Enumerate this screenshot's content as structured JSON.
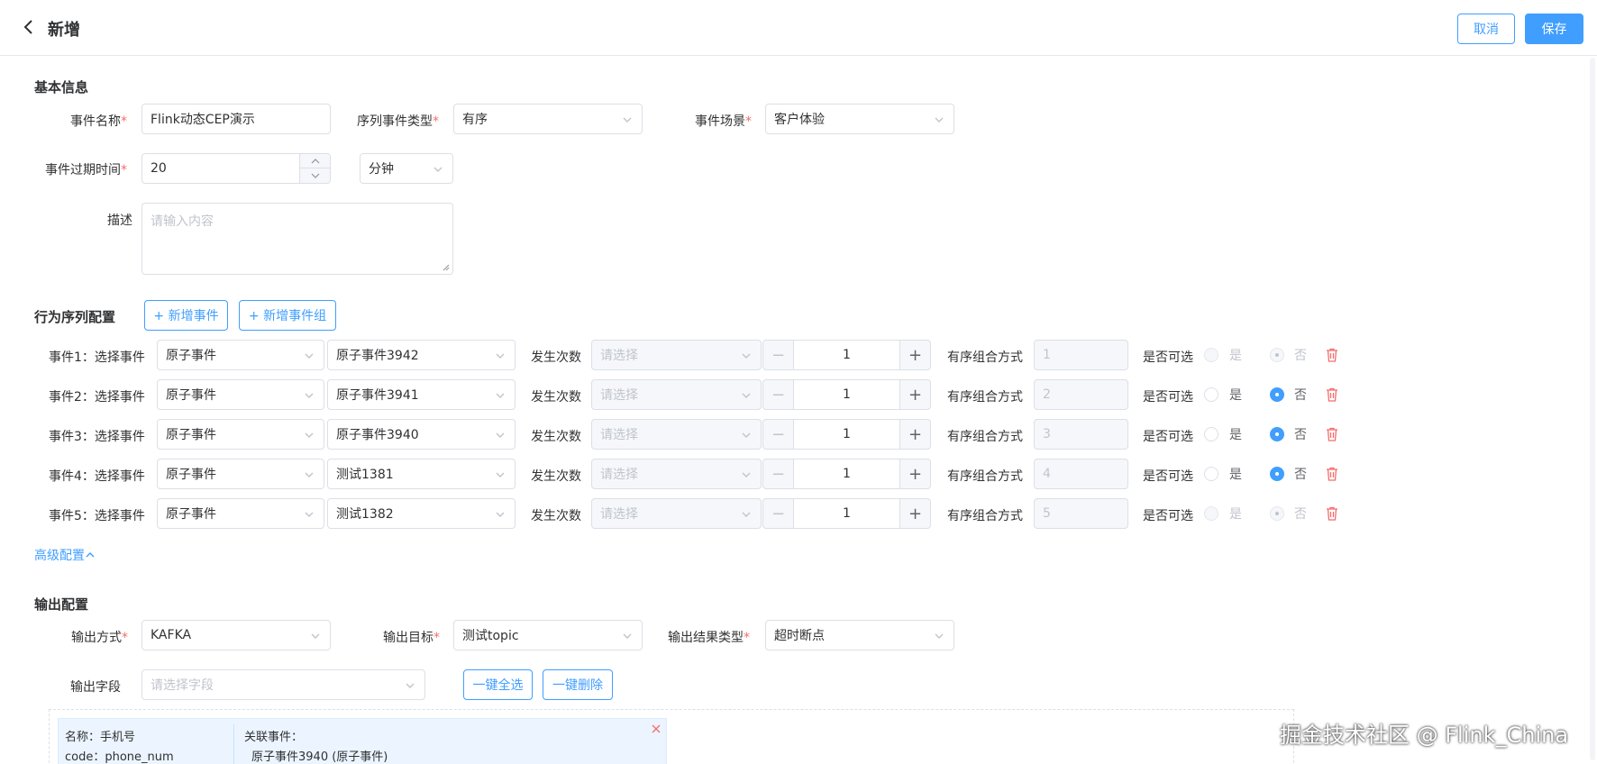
{
  "header": {
    "title": "新增",
    "cancel": "取消",
    "save": "保存"
  },
  "basic": {
    "section": "基本信息",
    "event_name_label": "事件名称",
    "event_name_value": "Flink动态CEP演示",
    "seq_type_label": "序列事件类型",
    "seq_type_value": "有序",
    "scene_label": "事件场景",
    "scene_value": "客户体验",
    "expire_label": "事件过期时间",
    "expire_value": "20",
    "expire_unit": "分钟",
    "desc_label": "描述",
    "desc_placeholder": "请输入内容"
  },
  "sequence": {
    "section": "行为序列配置",
    "add_event": "+ 新增事件",
    "add_group": "+ 新增事件组",
    "count_label": "发生次数",
    "count_placeholder": "请选择",
    "combo_label": "有序组合方式",
    "optional_label": "是否可选",
    "yes": "是",
    "no": "否",
    "rows": [
      {
        "label": "事件1：选择事件",
        "type": "原子事件",
        "event": "原子事件3942",
        "qty": "1",
        "combo": "1",
        "yes_disabled": true
      },
      {
        "label": "事件2：选择事件",
        "type": "原子事件",
        "event": "原子事件3941",
        "qty": "1",
        "combo": "2",
        "yes_disabled": false
      },
      {
        "label": "事件3：选择事件",
        "type": "原子事件",
        "event": "原子事件3940",
        "qty": "1",
        "combo": "3",
        "yes_disabled": false
      },
      {
        "label": "事件4：选择事件",
        "type": "原子事件",
        "event": "测试1381",
        "qty": "1",
        "combo": "4",
        "yes_disabled": false
      },
      {
        "label": "事件5：选择事件",
        "type": "原子事件",
        "event": "测试1382",
        "qty": "1",
        "combo": "5",
        "yes_disabled": true
      }
    ]
  },
  "advanced": {
    "label": "高级配置"
  },
  "output": {
    "section": "输出配置",
    "method_label": "输出方式",
    "method_value": "KAFKA",
    "target_label": "输出目标",
    "target_value": "测试topic",
    "result_label": "输出结果类型",
    "result_value": "超时断点",
    "fields_label": "输出字段",
    "fields_placeholder": "请选择字段",
    "select_all": "一键全选",
    "delete_all": "一键删除",
    "card": {
      "name": "名称：手机号",
      "code": "code：phone_num",
      "related_label": "关联事件：",
      "related_value": "原子事件3940 (原子事件)"
    }
  },
  "watermark": "掘金技术社区 @ Flink_China",
  "colors": {
    "primary": "#409eff",
    "required": "#f56c6c",
    "danger": "#f56c6c"
  }
}
